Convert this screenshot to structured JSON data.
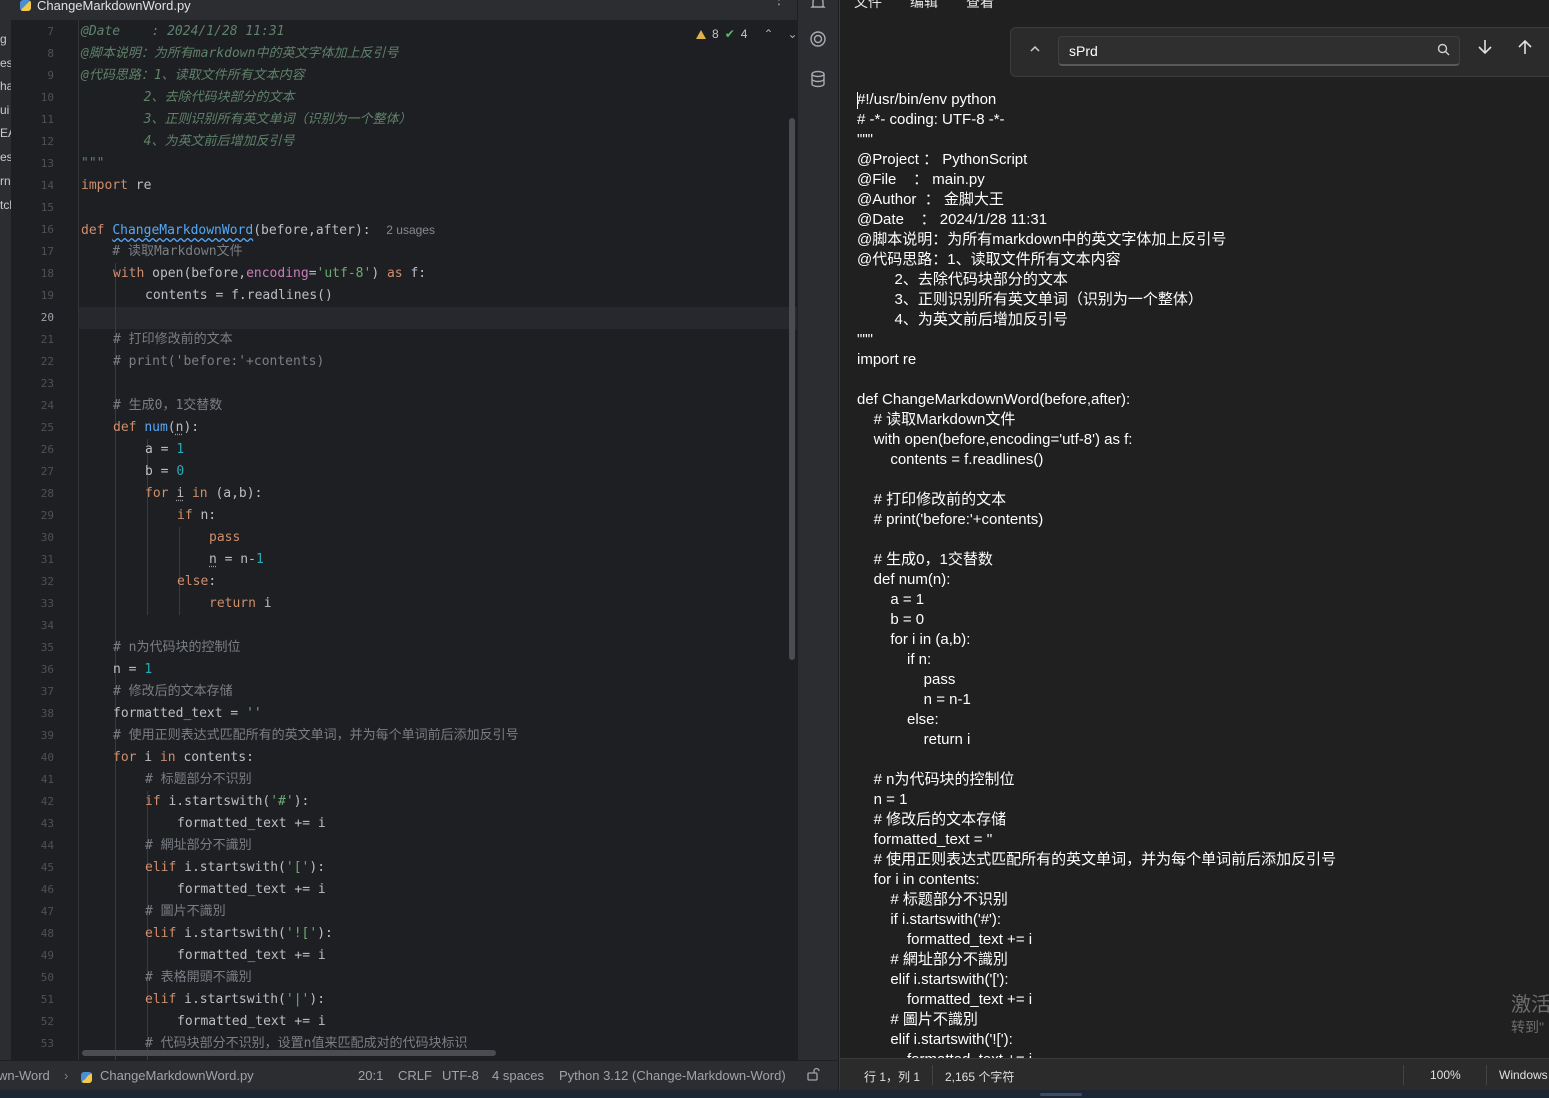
{
  "ide": {
    "tab_title": "ChangeMarkdownWord.py",
    "kebab": "⋮",
    "sidebar_cut_labels": [
      "g",
      "est",
      "ha",
      "ui",
      "EA",
      "es",
      "rna",
      "tcl"
    ],
    "inspections": {
      "warnings": "8",
      "ok": "4"
    },
    "line_numbers": [
      "7",
      "8",
      "9",
      "10",
      "11",
      "12",
      "13",
      "14",
      "15",
      "16",
      "17",
      "18",
      "19",
      "20",
      "21",
      "22",
      "23",
      "24",
      "25",
      "26",
      "27",
      "28",
      "29",
      "30",
      "31",
      "32",
      "33",
      "34",
      "35",
      "36",
      "37",
      "38",
      "39",
      "40",
      "41",
      "42",
      "43",
      "44",
      "45",
      "46",
      "47",
      "48",
      "49",
      "50",
      "51",
      "52",
      "53"
    ],
    "current_line": "20",
    "code": {
      "l7": "@Date    : 2024/1/28 11:31",
      "l8": "@脚本说明：为所有markdown中的英文字体加上反引号",
      "l9": "@代码思路：1、读取文件所有文本内容",
      "l10": "        2、去除代码块部分的文本",
      "l11": "        3、正则识别所有英文单词（识别为一个整体）",
      "l12": "        4、为英文前后增加反引号",
      "l13": "\"\"\"",
      "l14_kw": "import",
      "l14_rest": " re",
      "l16_kw": "def ",
      "l16_fn": "ChangeMarkdownWord",
      "l16_rest": "(before,after):",
      "l16_hint": "2 usages",
      "l17": "    # 读取Markdown文件",
      "l18_kw": "with",
      "l18_a": " open(before,",
      "l18_prm": "encoding",
      "l18_b": "=",
      "l18_str": "'utf-8'",
      "l18_c": ") ",
      "l18_kw2": "as",
      "l18_d": " f:",
      "l19": "contents = f.readlines()",
      "l21": "# 打印修改前的文本",
      "l22": "# print('before:'+contents)",
      "l24": "# 生成0，1交替数",
      "l25_kw": "def ",
      "l25_fn": "num",
      "l25_a": "(",
      "l25_n": "n",
      "l25_b": "):",
      "l26_a": "a = ",
      "l26_num": "1",
      "l27_a": "b = ",
      "l27_num": "0",
      "l28_kw": "for ",
      "l28_a": "i",
      "l28_kw2": " in ",
      "l28_b": "(a,b):",
      "l29_kw": "if",
      "l29_a": " n:",
      "l30_kw": "pass",
      "l31_n": "n",
      "l31_a": " = n-",
      "l31_num": "1",
      "l32_kw": "else",
      "l32_a": ":",
      "l33_kw": "return",
      "l33_a": " i",
      "l35": "# n为代码块的控制位",
      "l36_a": "n = ",
      "l36_num": "1",
      "l37": "# 修改后的文本存储",
      "l38_a": "formatted_text = ",
      "l38_str": "''",
      "l39": "# 使用正则表达式匹配所有的英文单词，并为每个单词前后添加反引号",
      "l40_kw": "for",
      "l40_a": " i ",
      "l40_kw2": "in",
      "l40_b": " contents:",
      "l41": "# 标题部分不识别",
      "l42_kw": "if",
      "l42_a": " i.startswith(",
      "l42_str": "'#'",
      "l42_b": "):",
      "l43": "formatted_text += i",
      "l44": "# 網址部分不識別",
      "l45_kw": "elif",
      "l45_a": " i.startswith(",
      "l45_str": "'['",
      "l45_b": "):",
      "l46": "formatted_text += i",
      "l47": "# 圖片不識別",
      "l48_kw": "elif",
      "l48_a": " i.startswith(",
      "l48_str": "'!['",
      "l48_b": "):",
      "l49": "formatted_text += i",
      "l50": "# 表格開頭不識別",
      "l51_kw": "elif",
      "l51_a": " i.startswith(",
      "l51_str": "'|'",
      "l51_b": "):",
      "l52": "formatted_text += i",
      "l53": "# 代码块部分不识别，设置n值来匹配成对的代码块标识"
    },
    "status": {
      "project": "wn-Word",
      "file": "ChangeMarkdownWord.py",
      "position": "20:1",
      "line_sep": "CRLF",
      "encoding": "UTF-8",
      "indent": "4 spaces",
      "interpreter": "Python 3.12 (Change-Markdown-Word)"
    }
  },
  "notepad": {
    "menu": [
      "文件",
      "编辑",
      "查看"
    ],
    "find": {
      "value": "sPrd"
    },
    "lines": [
      "#!/usr/bin/env python",
      "# -*- coding: UTF-8 -*-",
      "\"\"\"",
      "@Project ： PythonScript",
      "@File    ： main.py",
      "@Author  ： 金脚大王",
      "@Date    ： 2024/1/28 11:31",
      "@脚本说明：为所有markdown中的英文字体加上反引号",
      "@代码思路：1、读取文件所有文本内容",
      "         2、去除代码块部分的文本",
      "         3、正则识别所有英文单词（识别为一个整体）",
      "         4、为英文前后增加反引号",
      "\"\"\"",
      "import re",
      "",
      "def ChangeMarkdownWord(before,after):",
      "    # 读取Markdown文件",
      "    with open(before,encoding='utf-8') as f:",
      "        contents = f.readlines()",
      "",
      "    # 打印修改前的文本",
      "    # print('before:'+contents)",
      "",
      "    # 生成0，1交替数",
      "    def num(n):",
      "        a = 1",
      "        b = 0",
      "        for i in (a,b):",
      "            if n:",
      "                pass",
      "                n = n-1",
      "            else:",
      "                return i",
      "",
      "    # n为代码块的控制位",
      "    n = 1",
      "    # 修改后的文本存储",
      "    formatted_text = ''",
      "    # 使用正则表达式匹配所有的英文单词，并为每个单词前后添加反引号",
      "    for i in contents:",
      "        # 标题部分不识别",
      "        if i.startswith('#'):",
      "            formatted_text += i",
      "        # 網址部分不識別",
      "        elif i.startswith('['):",
      "            formatted_text += i",
      "        # 圖片不識別",
      "        elif i.startswith('!['):",
      "            formatted_text += i"
    ],
    "watermark": {
      "line1": "激活",
      "line2": "转到\""
    },
    "status": {
      "position": "行 1，列 1",
      "chars": "2,165 个字符",
      "zoom": "100%",
      "eol": "Windows"
    }
  }
}
